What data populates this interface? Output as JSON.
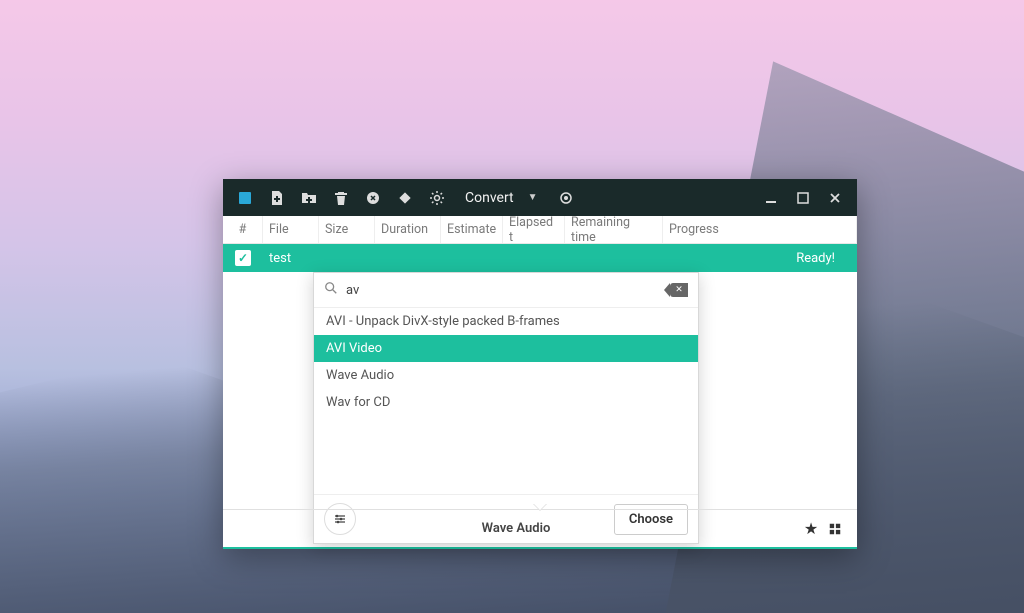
{
  "toolbar": {
    "dropdown_label": "Convert"
  },
  "columns": {
    "check": "#",
    "file": "File",
    "size": "Size",
    "duration": "Duration",
    "estimate": "Estimate",
    "elapsed": "Elapsed t",
    "remaining": "Remaining time",
    "progress": "Progress"
  },
  "rows": [
    {
      "file": "test",
      "status": "Ready!"
    }
  ],
  "popup": {
    "search_value": "av",
    "results": [
      {
        "label": "AVI - Unpack DivX-style packed B-frames",
        "selected": false
      },
      {
        "label": "AVI Video",
        "selected": true
      },
      {
        "label": "Wave Audio",
        "selected": false
      },
      {
        "label": "Wav for CD",
        "selected": false
      }
    ],
    "choose_label": "Choose"
  },
  "footer": {
    "format_label": "Wave Audio"
  },
  "colors": {
    "accent": "#1dbf9e",
    "titlebar": "#1a2a2a"
  }
}
